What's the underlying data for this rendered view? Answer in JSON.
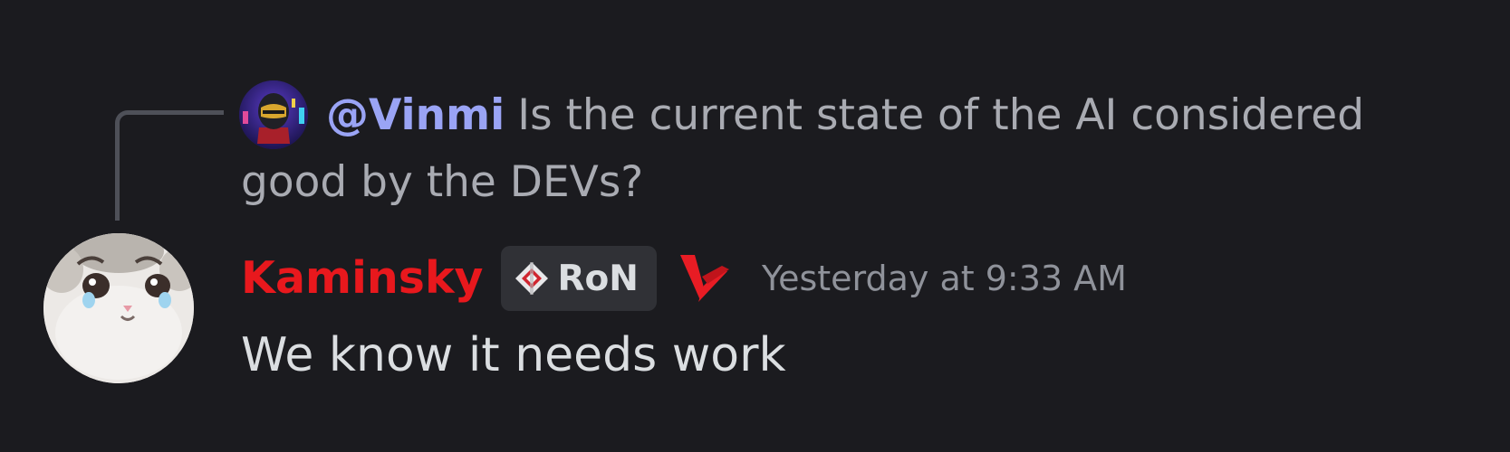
{
  "reply": {
    "mention": "@Vinmi",
    "text_line1": "Is the current state of the AI considered",
    "text_line2": "good by the DEVs?",
    "avatar_icon": "daft-punk-helmet-avatar"
  },
  "message": {
    "username": "Kaminsky",
    "username_color": "#e8181d",
    "tag_label": "RoN",
    "tag_icon": "ron-diamond-icon",
    "role_icon": "red-v-logo-icon",
    "timestamp": "Yesterday at 9:33 AM",
    "text": "We know it needs work",
    "avatar_icon": "crying-cat-avatar"
  },
  "colors": {
    "background": "#1b1b1f",
    "mention": "#9aa4f5",
    "muted_text": "#a9abb2",
    "body_text": "#dbdee1",
    "timestamp": "#8f929a"
  }
}
